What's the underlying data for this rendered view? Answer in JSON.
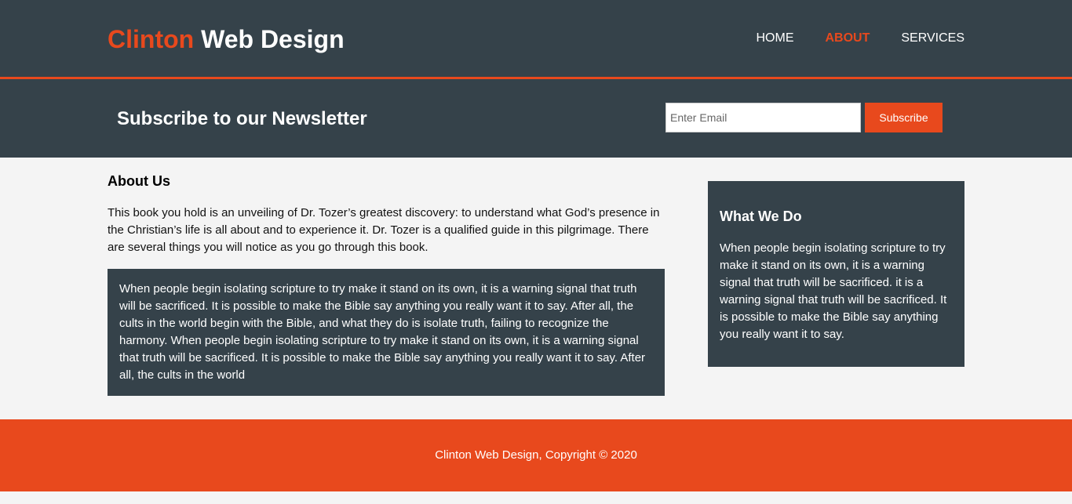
{
  "brand": {
    "highlight": "Clinton",
    "rest": " Web Design"
  },
  "nav": {
    "items": [
      {
        "label": "HOME",
        "current": false
      },
      {
        "label": "ABOUT",
        "current": true
      },
      {
        "label": "SERVICES",
        "current": false
      }
    ]
  },
  "newsletter": {
    "heading": "Subscribe to our Newsletter",
    "email_placeholder": "Enter Email",
    "email_value": "",
    "subscribe_label": "Subscribe"
  },
  "main": {
    "title": "About Us",
    "intro": "This book you hold is an unveiling of Dr. Tozer’s greatest discovery: to understand what God’s presence in the Christian’s life is all about and to experience it. Dr. Tozer is a qualified guide in this pilgrimage. There are several things you will notice as you go through this book.",
    "dark_box": "When people begin isolating scripture to try make it stand on its own, it is a warning signal that truth will be sacrificed. It is possible to make the Bible say anything you really want it to say. After all, the cults in the world begin with the Bible, and what they do is isolate truth, failing to recognize the harmony. When people begin isolating scripture to try make it stand on its own, it is a warning signal that truth will be sacrificed. It is possible to make the Bible say anything you really want it to say. After all, the cults in the world"
  },
  "sidebar": {
    "title": "What We Do",
    "text": "When people begin isolating scripture to try make it stand on its own, it is a warning signal that truth will be sacrificed. it is a warning signal that truth will be sacrificed. It is possible to make the Bible say anything you really want it to say."
  },
  "footer": {
    "text": "Clinton Web Design, Copyright © 2020"
  },
  "colors": {
    "dark": "#35424a",
    "accent": "#e8491d",
    "background": "#f4f4f4"
  }
}
